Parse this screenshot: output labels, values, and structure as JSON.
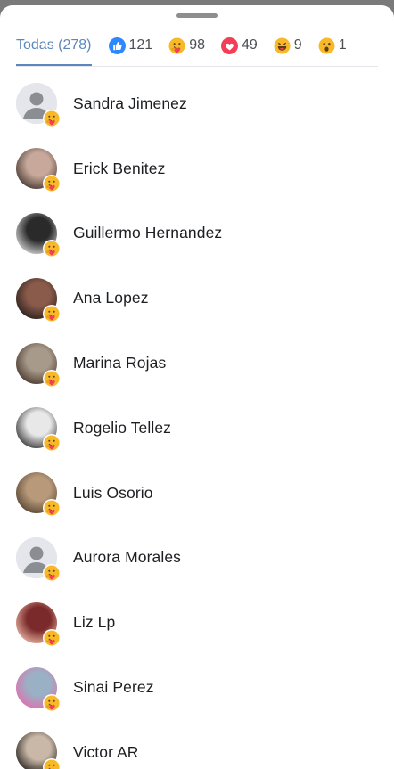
{
  "reactions_tabs": [
    {
      "key": "all",
      "label": "Todas (278)",
      "icon": null
    },
    {
      "key": "like",
      "label": "121",
      "icon": "like-icon"
    },
    {
      "key": "care",
      "label": "98",
      "icon": "care-icon"
    },
    {
      "key": "love",
      "label": "49",
      "icon": "love-icon"
    },
    {
      "key": "haha",
      "label": "9",
      "icon": "haha-icon"
    },
    {
      "key": "wow",
      "label": "1",
      "icon": "wow-icon"
    }
  ],
  "people": [
    {
      "name": "Sandra Jimenez",
      "avatar": "default-avatar",
      "reaction": "care-icon"
    },
    {
      "name": "Erick Benitez",
      "avatar": "photo-avatar",
      "reaction": "care-icon"
    },
    {
      "name": "Guillermo Hernandez",
      "avatar": "photo-avatar",
      "reaction": "care-icon"
    },
    {
      "name": "Ana Lopez",
      "avatar": "photo-avatar",
      "reaction": "care-icon"
    },
    {
      "name": "Marina Rojas",
      "avatar": "photo-avatar",
      "reaction": "care-icon"
    },
    {
      "name": "Rogelio Tellez",
      "avatar": "photo-avatar",
      "reaction": "care-icon"
    },
    {
      "name": "Luis Osorio",
      "avatar": "photo-avatar",
      "reaction": "care-icon"
    },
    {
      "name": "Aurora Morales",
      "avatar": "default-avatar",
      "reaction": "care-icon"
    },
    {
      "name": "Liz Lp",
      "avatar": "photo-avatar",
      "reaction": "care-icon"
    },
    {
      "name": "Sinai Perez",
      "avatar": "photo-avatar",
      "reaction": "care-icon"
    },
    {
      "name": "Victor AR",
      "avatar": "photo-avatar",
      "reaction": "care-icon"
    }
  ],
  "colors": {
    "accent": "#5b87bd",
    "like": "#2d88ff",
    "love": "#f33e58",
    "care_yellow": "#f7b928"
  }
}
